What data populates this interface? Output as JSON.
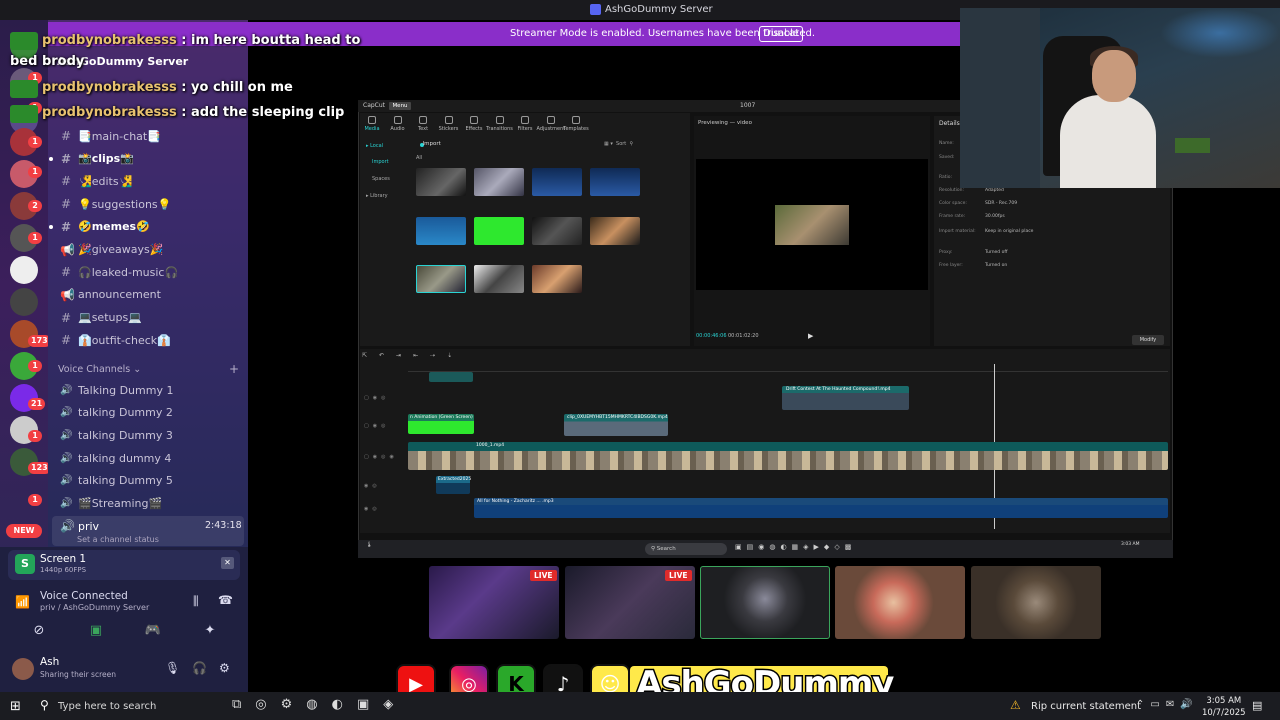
{
  "window": {
    "title": "AshGoDummy Server"
  },
  "streamer_banner": {
    "text": "Streamer Mode is enabled. Usernames have been truncated.",
    "button": "Disable"
  },
  "chat": [
    {
      "name": "prodbynobrakesss",
      "sep": " : ",
      "message": "im here boutta head to"
    },
    {
      "continuation": "bed brody"
    },
    {
      "name": "prodbynobrakesss",
      "sep": " : ",
      "message": "yo chill on me"
    },
    {
      "name": "prodbynobrakesss",
      "sep": " : ",
      "message": "add the sleeping clip"
    }
  ],
  "server": {
    "name": "AshGoDummy Server",
    "badges": [
      "1",
      "1",
      "1",
      "1",
      "2",
      "1",
      "173",
      "1",
      "21",
      "1",
      "123",
      "1",
      "NEW"
    ],
    "text_channels": [
      {
        "label": "📑main-chat📑",
        "icon": "hash-icon"
      },
      {
        "label": "📸clips📸",
        "icon": "hash-icon",
        "bold": true
      },
      {
        "label": "🧏‍♂️edits🧏‍♂️",
        "icon": "hash-icon"
      },
      {
        "label": "💡suggestions💡",
        "icon": "hash-icon"
      },
      {
        "label": "🤣memes🤣",
        "icon": "hash-icon",
        "bold": true
      },
      {
        "label": "🎉giveaways🎉",
        "icon": "megaphone-icon"
      },
      {
        "label": "🎧leaked-music🎧",
        "icon": "hash-icon"
      },
      {
        "label": "announcement",
        "icon": "megaphone-icon"
      },
      {
        "label": "💻setups💻",
        "icon": "hash-icon"
      },
      {
        "label": "👔outfit-check👔",
        "icon": "hash-icon"
      }
    ],
    "voice_category": "Voice Channels",
    "voice_channels": [
      "Talking Dummy 1",
      "talking Dummy 2",
      "talking Dummy 3",
      "talking dummy 4",
      "talking Dummy 5",
      "🎬Streaming🎬"
    ],
    "active_voice": {
      "name": "priv",
      "time": "2:43:18",
      "status": "Set a channel status"
    }
  },
  "screen_share": {
    "title": "Screen 1",
    "quality": "1440p 60FPS"
  },
  "voice": {
    "title": "Voice Connected",
    "location": "priv / AshGoDummy Server"
  },
  "user": {
    "name": "Ash",
    "status": "Sharing their screen"
  },
  "capcut": {
    "logo": "CapCut",
    "menu": "Menu",
    "project": "1007",
    "tools": [
      "Media",
      "Audio",
      "Text",
      "Stickers",
      "Effects",
      "Transitions",
      "Filters",
      "Adjustment",
      "Templates"
    ],
    "side": [
      "Local",
      "Import",
      "Spaces",
      "Library"
    ],
    "import_label": "Import",
    "filter_all": "All",
    "sort": "Sort",
    "preview_title": "Previewing — video",
    "time_current": "00:00:46:06",
    "time_total": "00:01:02:20",
    "details_title": "Details",
    "details": [
      {
        "k": "Name:",
        "v": ""
      },
      {
        "k": "Saved:",
        "v": ""
      },
      {
        "k": "Ratio:",
        "v": ""
      },
      {
        "k": "Resolution:",
        "v": "Adapted"
      },
      {
        "k": "Color space:",
        "v": "SDR - Rec.709"
      },
      {
        "k": "Frame rate:",
        "v": "30.00fps"
      },
      {
        "k": "Import material:",
        "v": "Keep in original place"
      },
      {
        "k": "Proxy:",
        "v": "Turned off"
      },
      {
        "k": "Free layer:",
        "v": "Turned on"
      }
    ],
    "modify": "Modify",
    "clips": [
      "Drift Contest At The Haunted Compound!.mp4",
      "n Animation (Green Screen)",
      "clip_0XUEMYHBT15MHMKRTC4IBDSG0K.mp4",
      "1000_1.mp4",
      "Extracted2025",
      "All for Nothing - Zacharitz ... .mp3"
    ],
    "taskbar_search": "Search",
    "taskbar_time": "3:03 AM"
  },
  "live_label": "LIVE",
  "brand": "AshGoDummy",
  "taskbar": {
    "search_placeholder": "Type here to search",
    "news": "Rip current statement",
    "time": "3:05 AM",
    "date": "10/7/2025"
  },
  "colors": {
    "streamer_bar": "#8a2ec9",
    "accent_teal": "#2ad4d4",
    "badge_red": "#f23f43",
    "green": "#23a559"
  }
}
